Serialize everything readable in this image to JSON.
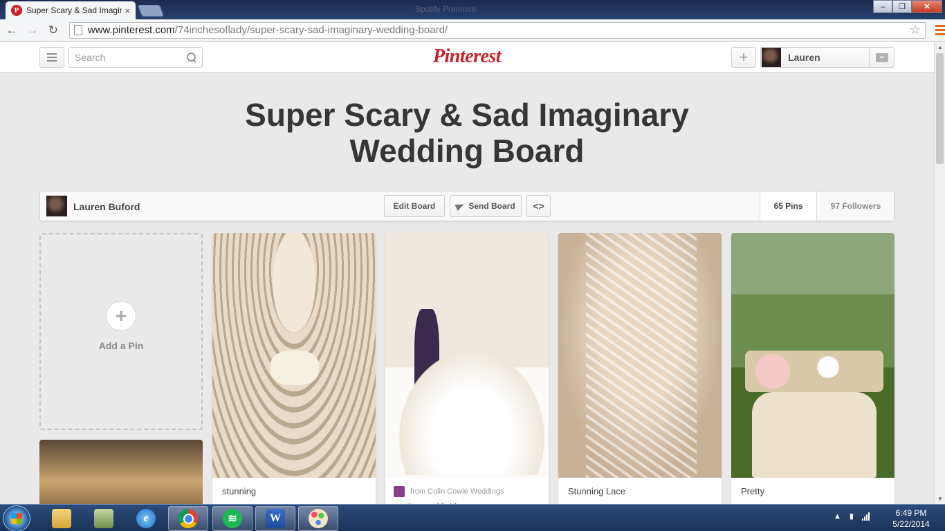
{
  "browser": {
    "tab_title": "Super Scary & Sad Imagin",
    "tab_favicon": "P",
    "tab_close": "×",
    "url_host": "www.pinterest.com",
    "url_path": "/74inchesoflady/super-scary-sad-imaginary-wedding-board/",
    "window_title": "Spotify Premium"
  },
  "header": {
    "search_placeholder": "Search",
    "logo": "Pinterest",
    "user_name": "Lauren",
    "add_label": "+"
  },
  "board": {
    "title": "Super Scary & Sad Imaginary Wedding Board",
    "owner": "Lauren Buford",
    "edit_label": "Edit Board",
    "send_label": "Send Board",
    "embed_label": "<>",
    "pins_count": "65 Pins",
    "followers_count": "97 Followers"
  },
  "add_pin_label": "Add a Pin",
  "pins": [
    {
      "caption": "stunning"
    },
    {
      "source": "from Colin Cowie Weddings",
      "caption": "mother and bride"
    },
    {
      "caption": "Stunning Lace"
    },
    {
      "caption": "Pretty"
    }
  ],
  "taskbar": {
    "time": "6:49 PM",
    "date": "5/22/2014",
    "apps": [
      "folder-icon",
      "store-icon",
      "ie-icon",
      "chrome-icon",
      "spotify-icon",
      "word-icon",
      "paint-icon"
    ]
  },
  "colors": {
    "brand": "#cb2027",
    "background": "#e9e9e9",
    "taskbar": "#1a3358"
  }
}
